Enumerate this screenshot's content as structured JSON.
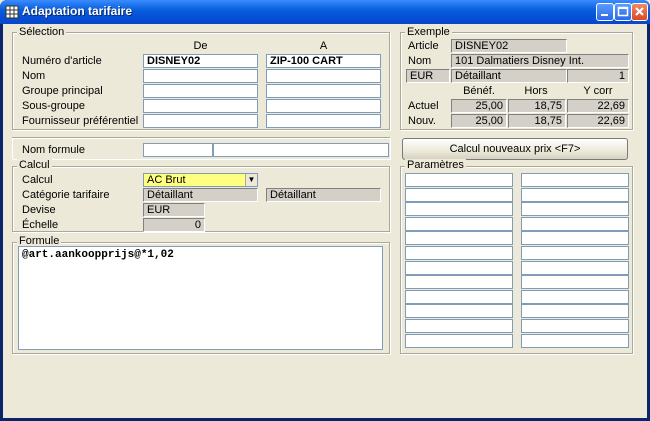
{
  "window": {
    "title": "Adaptation tarifaire"
  },
  "selection": {
    "group_label": "Sélection",
    "col_from": "De",
    "col_to": "A",
    "rows": [
      {
        "label": "Numéro d'article",
        "from": "DISNEY02",
        "to": "ZIP-100 CART"
      },
      {
        "label": "Nom",
        "from": "",
        "to": ""
      },
      {
        "label": "Groupe principal",
        "from": "",
        "to": ""
      },
      {
        "label": "Sous-groupe",
        "from": "",
        "to": ""
      },
      {
        "label": "Fournisseur préférentiel",
        "from": "",
        "to": ""
      }
    ]
  },
  "exemple": {
    "group_label": "Exemple",
    "article_label": "Article",
    "article_value": "DISNEY02",
    "nom_label": "Nom",
    "nom_value": "101 Dalmatiers Disney Int.",
    "currency": "EUR",
    "category": "Détaillant",
    "category_num": "1",
    "col_benef": "Bénéf.",
    "col_hors": "Hors",
    "col_ycorr": "Y corr",
    "actuel_label": "Actuel",
    "actuel": [
      "25,00",
      "18,75",
      "22,69"
    ],
    "nouv_label": "Nouv.",
    "nouv": [
      "25,00",
      "18,75",
      "22,69"
    ]
  },
  "formule": {
    "nom_label": "Nom formule",
    "nom_value": "",
    "calc_button": "Calcul nouveaux prix <F7>"
  },
  "calcul": {
    "group_label": "Calcul",
    "calcul_label": "Calcul",
    "calcul_value": "AC Brut",
    "categorie_label": "Catégorie tarifaire",
    "categorie_from": "Détaillant",
    "categorie_to": "Détaillant",
    "devise_label": "Devise",
    "devise_value": "EUR",
    "echelle_label": "Échelle",
    "echelle_value": "0",
    "combo_color": "#ffff80"
  },
  "formula_box": {
    "group_label": "Formule",
    "text": "@art.aankoopprijs@*1,02"
  },
  "parametres": {
    "group_label": "Paramètres"
  }
}
